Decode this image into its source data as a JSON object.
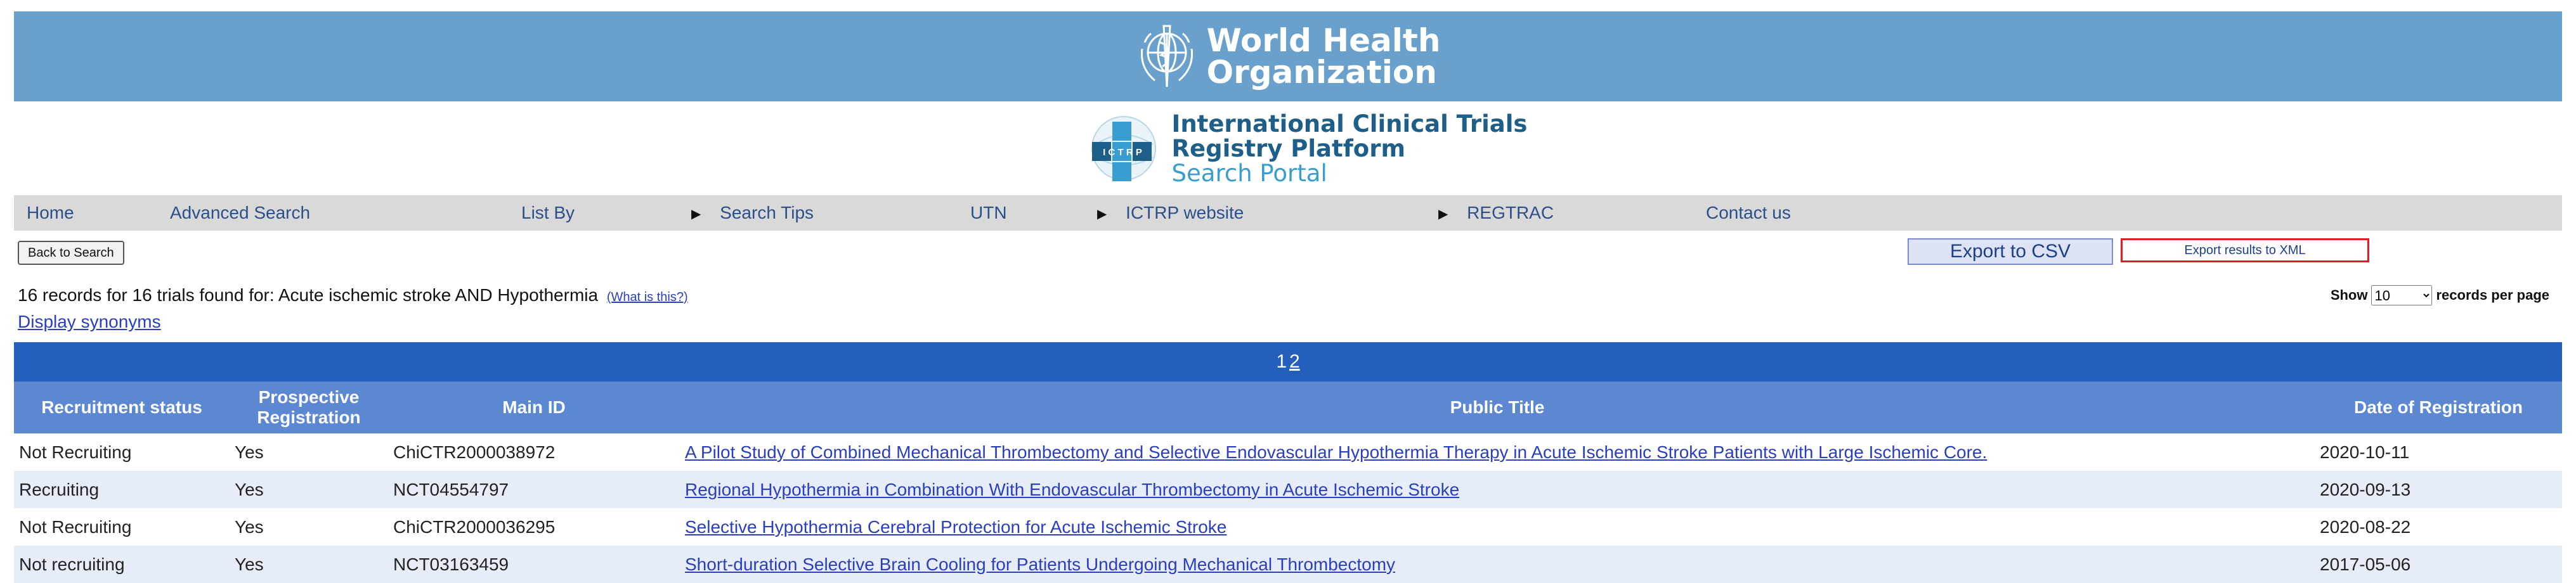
{
  "header": {
    "who": {
      "line1": "World Health",
      "line2": "Organization"
    },
    "ictrp": {
      "line1": "International Clinical Trials",
      "line2": "Registry Platform",
      "line3": "Search Portal",
      "badge": "I C T R P"
    }
  },
  "nav": {
    "items": [
      {
        "label": "Home",
        "arrow": false
      },
      {
        "label": "Advanced Search",
        "arrow": false
      },
      {
        "label": "List By",
        "arrow": false
      },
      {
        "label": "Search Tips",
        "arrow": true
      },
      {
        "label": "UTN",
        "arrow": false
      },
      {
        "label": "ICTRP website",
        "arrow": true
      },
      {
        "label": "REGTRAC",
        "arrow": true
      },
      {
        "label": "Contact us",
        "arrow": false
      }
    ]
  },
  "toolbar": {
    "back_label": "Back to Search",
    "export_csv_label": "Export to CSV",
    "export_xml_label": "Export results to XML"
  },
  "summary": {
    "text": "16 records for 16 trials found for: Acute ischemic stroke AND Hypothermia",
    "what_link": "(What is this?)",
    "synonyms_link": "Display synonyms",
    "show_label": "Show",
    "per_page_value": "10",
    "per_page_suffix": "records per page"
  },
  "pager": {
    "current": "1",
    "next": "2"
  },
  "table": {
    "headers": {
      "recruitment": "Recruitment status",
      "prospective_l1": "Prospective",
      "prospective_l2": "Registration",
      "main_id": "Main ID",
      "title": "Public Title",
      "date": "Date of Registration"
    },
    "rows": [
      {
        "status": "Not Recruiting",
        "prospective": "Yes",
        "main_id": "ChiCTR2000038972",
        "title": "A Pilot Study of Combined Mechanical Thrombectomy and Selective Endovascular Hypothermia Therapy in Acute Ischemic Stroke Patients with Large Ischemic Core.",
        "date": "2020-10-11"
      },
      {
        "status": "Recruiting",
        "prospective": "Yes",
        "main_id": "NCT04554797",
        "title": "Regional Hypothermia in Combination With Endovascular Thrombectomy in Acute Ischemic Stroke",
        "date": "2020-09-13"
      },
      {
        "status": "Not Recruiting",
        "prospective": "Yes",
        "main_id": "ChiCTR2000036295",
        "title": "Selective Hypothermia Cerebral Protection for Acute Ischemic Stroke",
        "date": "2020-08-22"
      },
      {
        "status": "Not recruiting",
        "prospective": "Yes",
        "main_id": "NCT03163459",
        "title": "Short-duration Selective Brain Cooling for Patients Undergoing Mechanical Thrombectomy",
        "date": "2017-05-06"
      }
    ]
  },
  "colors": {
    "who_banner": "#6aa0cc",
    "nav_bg": "#d9d9d9",
    "pager_bg": "#245fbb",
    "header_bg": "#5c87d1",
    "link": "#2a3fc0",
    "xml_border": "#e01b24"
  }
}
